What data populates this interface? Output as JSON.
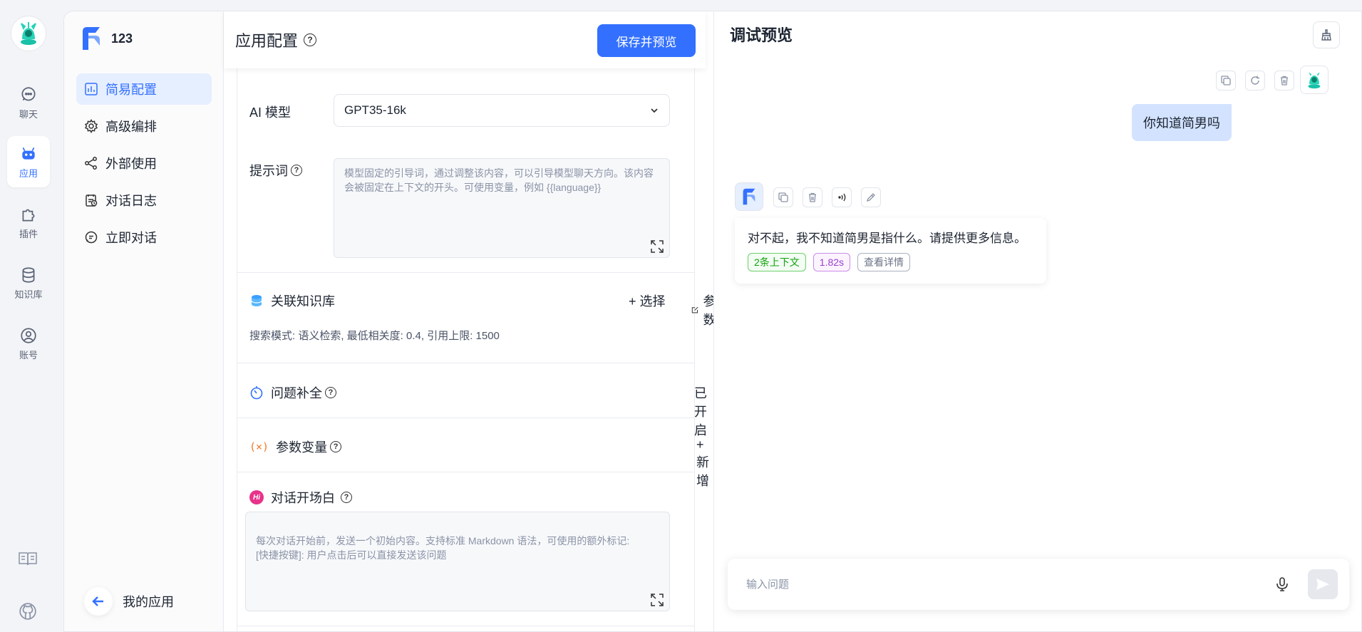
{
  "rail": {
    "items": [
      {
        "label": "聊天",
        "icon": "chat-icon",
        "active": false
      },
      {
        "label": "应用",
        "icon": "robot-icon",
        "active": true
      },
      {
        "label": "插件",
        "icon": "puzzle-icon",
        "active": false
      },
      {
        "label": "知识库",
        "icon": "database-icon",
        "active": false
      },
      {
        "label": "账号",
        "icon": "user-icon",
        "active": false
      }
    ],
    "bottom_icons": [
      "book-icon",
      "github-icon"
    ]
  },
  "sidebar": {
    "app_name": "123",
    "items": [
      {
        "label": "简易配置",
        "icon": "chart-icon",
        "active": true
      },
      {
        "label": "高级编排",
        "icon": "gear-icon",
        "active": false
      },
      {
        "label": "外部使用",
        "icon": "share-icon",
        "active": false
      },
      {
        "label": "对话日志",
        "icon": "log-icon",
        "active": false
      },
      {
        "label": "立即对话",
        "icon": "message-icon",
        "active": false
      }
    ],
    "my_apps": "我的应用"
  },
  "config": {
    "title": "应用配置",
    "save_button": "保存并预览",
    "model_label": "AI 模型",
    "model_value": "GPT35-16k",
    "prompt_label": "提示词",
    "prompt_placeholder": "模型固定的引导词，通过调整该内容，可以引导模型聊天方向。该内容会被固定在上下文的开头。可使用变量，例如 {{language}}",
    "knowledge": {
      "title": "关联知识库",
      "select": "+ 选择",
      "params": "参数",
      "info": "搜索模式: 语义检索, 最低相关度: 0.4, 引用上限: 1500"
    },
    "question_complete": {
      "title": "问题补全",
      "status": "已开启"
    },
    "variables": {
      "title": "参数变量",
      "add": "+ 新增"
    },
    "opening": {
      "title": "对话开场白",
      "placeholder": "每次对话开始前，发送一个初始内容。支持标准 Markdown 语法，可使用的额外标记:\n[快捷按键]: 用户点击后可以直接发送该问题"
    }
  },
  "preview": {
    "title": "调试预览",
    "user_message": "你知道简男吗",
    "ai_message": "对不起，我不知道简男是指什么。请提供更多信息。",
    "tags": [
      "2条上下文",
      "1.82s",
      "查看详情"
    ],
    "input_placeholder": "输入问题"
  },
  "colors": {
    "accent": "#3370ff",
    "user_bubble": "#d3e3ff",
    "tag_green": "#13a10e",
    "tag_purple": "#9b3fcf"
  }
}
